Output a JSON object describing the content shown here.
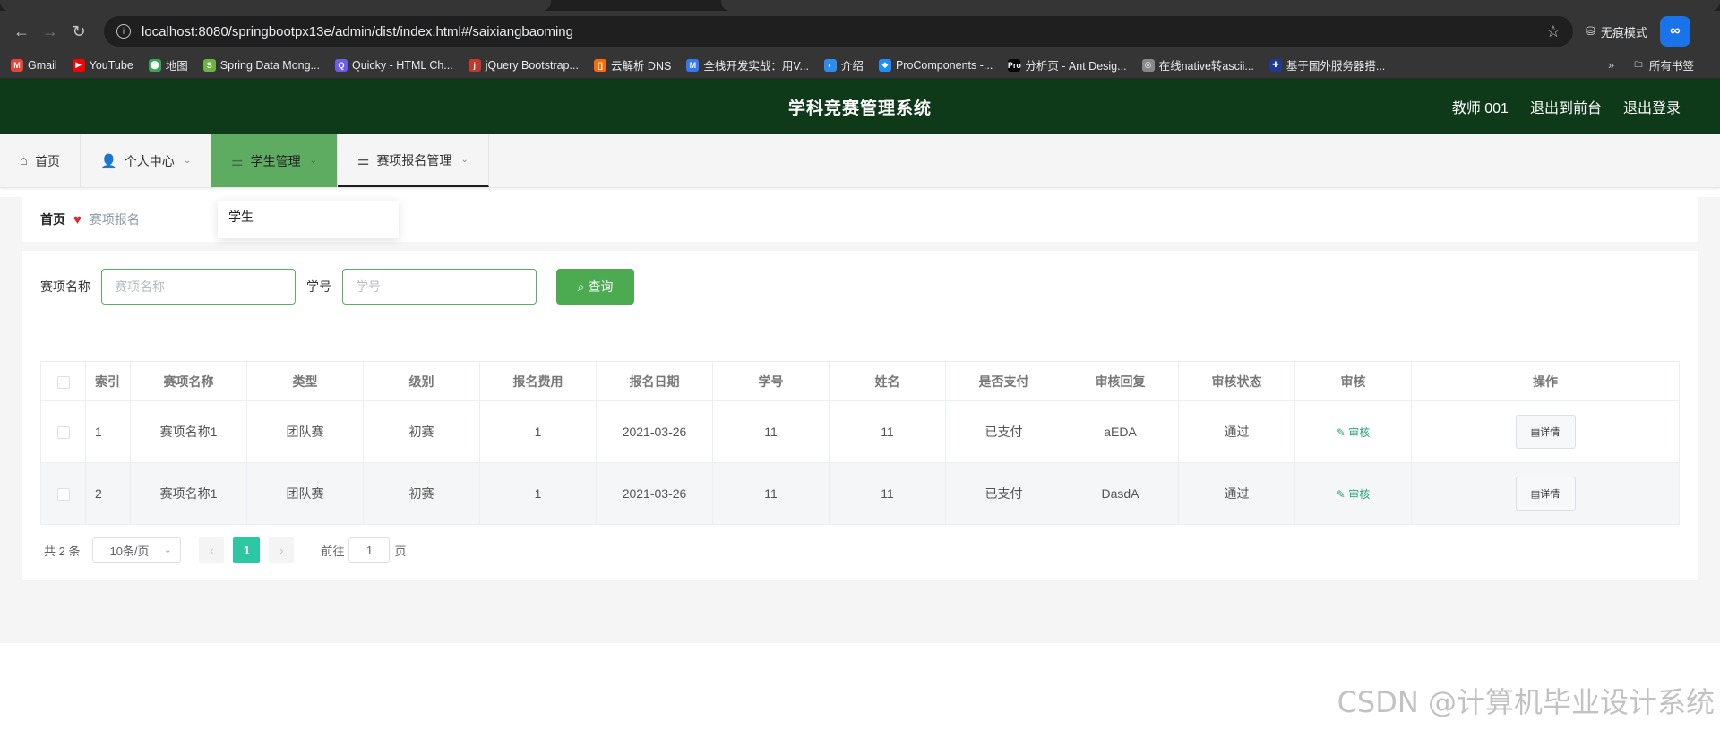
{
  "browser": {
    "url": "localhost:8080/springbootpx13e/admin/dist/index.html#/saixiangbaoming",
    "incognito_label": "无痕模式",
    "ext_label": "∞"
  },
  "bookmarks": [
    {
      "label": "Gmail",
      "color": "#ea4335",
      "glyph": "M"
    },
    {
      "label": "YouTube",
      "color": "#ff0000",
      "glyph": "▶"
    },
    {
      "label": "地图",
      "color": "#34a853",
      "glyph": "⬤"
    },
    {
      "label": "Spring Data Mong...",
      "color": "#6db33f",
      "glyph": "S"
    },
    {
      "label": "Quicky - HTML Ch...",
      "color": "#6c5ce7",
      "glyph": "Q"
    },
    {
      "label": "jQuery Bootstrap...",
      "color": "#c0392b",
      "glyph": "j"
    },
    {
      "label": "云解析 DNS",
      "color": "#ff6a00",
      "glyph": "[]"
    },
    {
      "label": "全栈开发实战：用V...",
      "color": "#3478f6",
      "glyph": "M"
    },
    {
      "label": "介绍",
      "color": "#2d8cf0",
      "glyph": "◐"
    },
    {
      "label": "ProComponents -...",
      "color": "#1890ff",
      "glyph": "◆"
    },
    {
      "label": "分析页 - Ant Desig...",
      "color": "#000000",
      "glyph": "Pro"
    },
    {
      "label": "在线native转ascii...",
      "color": "#888888",
      "glyph": "◎"
    },
    {
      "label": "基于国外服务器搭...",
      "color": "#1f3a93",
      "glyph": "✚"
    }
  ],
  "bookmarks_all": "所有书签",
  "header": {
    "title": "学科竞赛管理系统",
    "user": "教师 001",
    "to_front": "退出到前台",
    "logout": "退出登录"
  },
  "menu": [
    {
      "label": "首页",
      "icon": "home-icon",
      "glyph": "⌂",
      "chevron": false
    },
    {
      "label": "个人中心",
      "icon": "user-icon",
      "glyph": "👤",
      "chevron": true
    },
    {
      "label": "学生管理",
      "icon": "sliders-icon",
      "glyph": "⚌",
      "chevron": true
    },
    {
      "label": "赛项报名管理",
      "icon": "sliders-icon",
      "glyph": "⚌",
      "chevron": true
    }
  ],
  "dropdown": {
    "item": "学生"
  },
  "breadcrumb": {
    "home": "首页",
    "current": "赛项报名"
  },
  "search": {
    "name_label": "赛项名称",
    "name_placeholder": "赛项名称",
    "id_label": "学号",
    "id_placeholder": "学号",
    "button": "查询"
  },
  "table": {
    "headers": [
      "索引",
      "赛项名称",
      "类型",
      "级别",
      "报名费用",
      "报名日期",
      "学号",
      "姓名",
      "是否支付",
      "审核回复",
      "审核状态",
      "审核",
      "操作"
    ],
    "rows": [
      [
        "1",
        "赛项名称1",
        "团队赛",
        "初赛",
        "1",
        "2021-03-26",
        "11",
        "11",
        "已支付",
        "aEDA",
        "通过"
      ],
      [
        "2",
        "赛项名称1",
        "团队赛",
        "初赛",
        "1",
        "2021-03-26",
        "11",
        "11",
        "已支付",
        "DasdA",
        "通过"
      ]
    ],
    "audit_label": "审核",
    "detail_label": "详情"
  },
  "pager": {
    "total": "共 2 条",
    "page_size": "10条/页",
    "current": "1",
    "goto_prefix": "前往",
    "goto_value": "1",
    "goto_suffix": "页"
  },
  "watermark": "CSDN @计算机毕业设计系统"
}
